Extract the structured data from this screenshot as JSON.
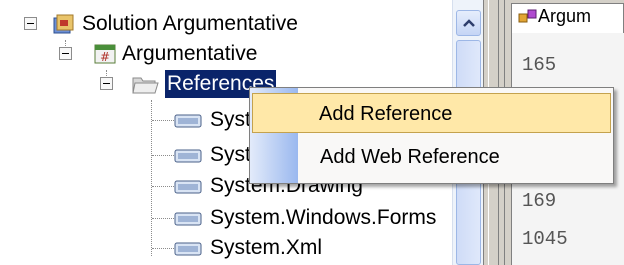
{
  "solution_explorer": {
    "nodes": [
      {
        "label": "Solution Argumentative",
        "icon": "solution-icon"
      },
      {
        "label": "Argumentative",
        "icon": "csharp-project-icon"
      },
      {
        "label": "References",
        "icon": "folder-icon"
      },
      {
        "label": "System",
        "icon": "reference-icon"
      },
      {
        "label": "System.Data",
        "icon": "reference-icon"
      },
      {
        "label": "System.Drawing",
        "icon": "reference-icon"
      },
      {
        "label": "System.Windows.Forms",
        "icon": "reference-icon"
      },
      {
        "label": "System.Xml",
        "icon": "reference-icon"
      }
    ]
  },
  "context_menu": {
    "items": [
      {
        "label": "Add Reference",
        "highlighted": true
      },
      {
        "label": "Add Web Reference",
        "highlighted": false
      }
    ]
  },
  "editor": {
    "tab_label": "Argum",
    "line_numbers": [
      "165",
      "169",
      "1045"
    ]
  }
}
